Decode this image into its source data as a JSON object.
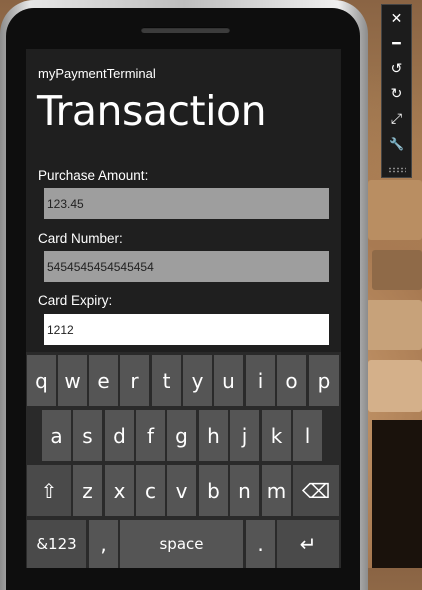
{
  "app": {
    "name": "myPaymentTerminal",
    "page_title": "Transaction"
  },
  "form": {
    "purchase_amount": {
      "label": "Purchase Amount:",
      "value": "123.45",
      "enabled": false
    },
    "card_number": {
      "label": "Card Number:",
      "value": "5454545454545454",
      "enabled": false
    },
    "card_expiry": {
      "label": "Card Expiry:",
      "value": "1212",
      "enabled": true
    }
  },
  "keyboard": {
    "row1": [
      "q",
      "w",
      "e",
      "r",
      "t",
      "y",
      "u",
      "i",
      "o",
      "p"
    ],
    "row2": [
      "a",
      "s",
      "d",
      "f",
      "g",
      "h",
      "j",
      "k",
      "l"
    ],
    "row3": [
      "z",
      "x",
      "c",
      "v",
      "b",
      "n",
      "m"
    ],
    "shift_glyph": "⇧",
    "backspace_glyph": "⌫",
    "symbols_label": "&123",
    "comma_label": ",",
    "space_label": "space",
    "period_label": ".",
    "enter_glyph": "↵"
  },
  "toolbar": {
    "icons": [
      "close-icon",
      "minimize-icon",
      "rotate-left-icon",
      "rotate-right-icon",
      "fit-to-screen-icon",
      "settings-wrench-icon"
    ],
    "glyphs": [
      "✕",
      "━",
      "↺",
      "↻",
      "⤢",
      "🔧"
    ]
  },
  "colors": {
    "screen_bg": "#1f1f1f",
    "key_bg": "#555555",
    "disabled_field": "#9e9e9e",
    "active_field": "#ffffff"
  }
}
